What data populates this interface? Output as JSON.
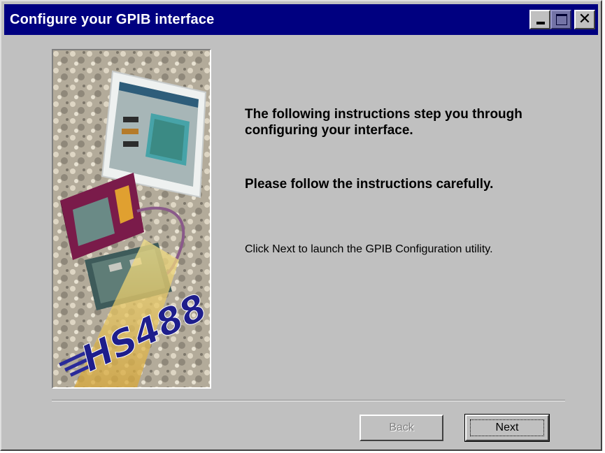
{
  "window": {
    "title": "Configure your GPIB interface",
    "controls": {
      "minimize_icon": "minimize-icon",
      "maximize_icon": "maximize-icon",
      "close_icon": "close-icon",
      "close_glyph": "✕"
    }
  },
  "artwork": {
    "logo_text": "HS488"
  },
  "content": {
    "line1": "The following instructions step you through configuring your interface.",
    "line2": "Please follow the instructions carefully.",
    "line3": "Click Next to launch the GPIB Configuration utility."
  },
  "buttons": {
    "back": {
      "label": "Back",
      "enabled": false
    },
    "next": {
      "label": "Next",
      "enabled": true
    }
  },
  "colors": {
    "titlebar": "#000080",
    "face": "#c0c0c0"
  }
}
